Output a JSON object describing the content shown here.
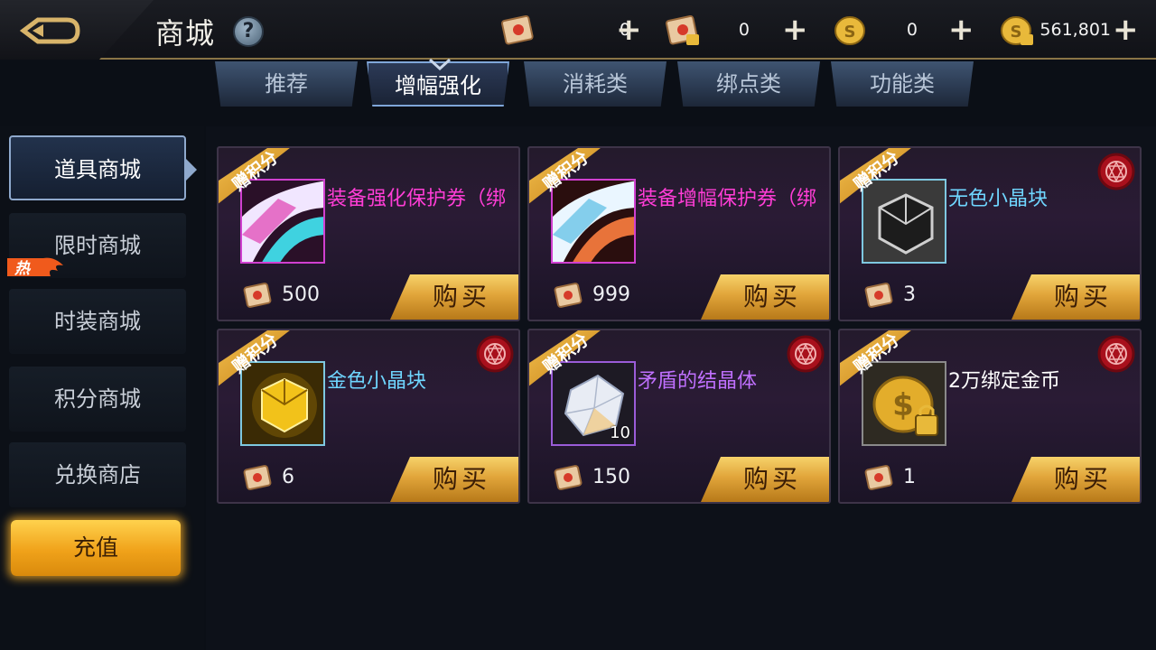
{
  "header": {
    "title": "商城",
    "help_icon": "question-icon",
    "currencies": [
      {
        "name": "points-scroll",
        "value": "0",
        "icon": "scroll-icon"
      },
      {
        "name": "bound-points-scroll",
        "value": "0",
        "icon": "locked-scroll-icon"
      },
      {
        "name": "gold-coin",
        "value": "0",
        "icon": "coin-icon"
      },
      {
        "name": "bound-gold-coin",
        "value": "561,801",
        "icon": "locked-coin-icon"
      }
    ],
    "plus_symbol": "+"
  },
  "tabs": [
    {
      "label": "推荐",
      "active": false
    },
    {
      "label": "增幅强化",
      "active": true
    },
    {
      "label": "消耗类",
      "active": false
    },
    {
      "label": "绑点类",
      "active": false
    },
    {
      "label": "功能类",
      "active": false
    }
  ],
  "sidebar": {
    "items": [
      {
        "label": "道具商城",
        "active": true
      },
      {
        "label": "限时商城",
        "active": false,
        "badge": "热"
      },
      {
        "label": "时装商城",
        "active": false
      },
      {
        "label": "积分商城",
        "active": false
      },
      {
        "label": "兑换商店",
        "active": false
      }
    ],
    "recharge_label": "充值"
  },
  "items": [
    {
      "name": "装备强化保护券（绑",
      "name_color": "#ff3dd6",
      "price": "500",
      "ribbon": "赠积分",
      "buy_label": "购买",
      "border": "pink",
      "icon": "enhance-protect-ticket-icon",
      "seal": false,
      "qty": ""
    },
    {
      "name": "装备增幅保护券（绑",
      "name_color": "#ff3dd6",
      "price": "999",
      "ribbon": "赠积分",
      "buy_label": "购买",
      "border": "pink",
      "icon": "amplify-protect-ticket-icon",
      "seal": false,
      "qty": ""
    },
    {
      "name": "无色小晶块",
      "name_color": "#6fd6ff",
      "price": "3",
      "ribbon": "赠积分",
      "buy_label": "购买",
      "border": "cyan",
      "icon": "colorless-crystal-icon",
      "seal": true,
      "qty": ""
    },
    {
      "name": "金色小晶块",
      "name_color": "#6fd6ff",
      "price": "6",
      "ribbon": "赠积分",
      "buy_label": "购买",
      "border": "cyan",
      "icon": "gold-crystal-icon",
      "seal": true,
      "qty": ""
    },
    {
      "name": "矛盾的结晶体",
      "name_color": "#c070ff",
      "price": "150",
      "ribbon": "赠积分",
      "buy_label": "购买",
      "border": "purple",
      "icon": "contradiction-crystal-icon",
      "seal": true,
      "qty": "10"
    },
    {
      "name": "2万绑定金币",
      "name_color": "#ffffff",
      "price": "1",
      "ribbon": "赠积分",
      "buy_label": "购买",
      "border": "grey",
      "icon": "bound-gold-coin-icon",
      "seal": true,
      "qty": ""
    }
  ]
}
